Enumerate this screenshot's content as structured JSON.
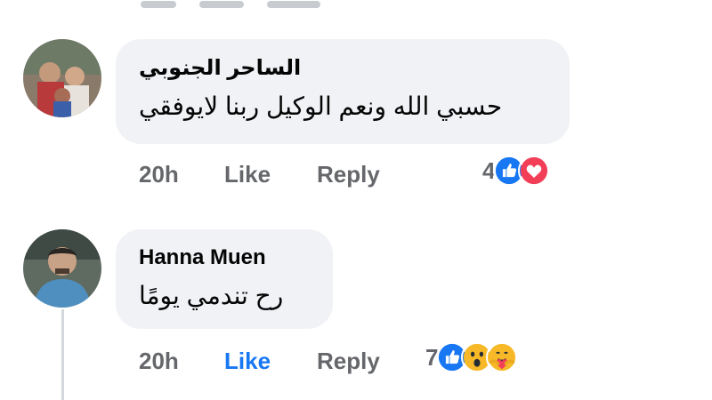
{
  "comments": [
    {
      "author": "الساحر الجنوبي",
      "text": "حسبي الله ونعم الوكيل ربنا لايوفقي",
      "time": "20h",
      "like_label": "Like",
      "reply_label": "Reply",
      "reaction_count": "4",
      "reactions": [
        "like-reaction-icon",
        "love-reaction-icon"
      ],
      "liked": false
    },
    {
      "author": "Hanna Muen",
      "text": "رح تندمي يومًا",
      "time": "20h",
      "like_label": "Like",
      "reply_label": "Reply",
      "reaction_count": "7",
      "reactions": [
        "like-reaction-icon",
        "wow-reaction-icon",
        "care-reaction-icon"
      ],
      "liked": true
    }
  ],
  "colors": {
    "bubble_bg": "#f0f2f5",
    "meta_text": "#65676b",
    "like_active": "#1877f2",
    "love_red": "#f33e58",
    "reaction_yellow": "#f7b928"
  }
}
